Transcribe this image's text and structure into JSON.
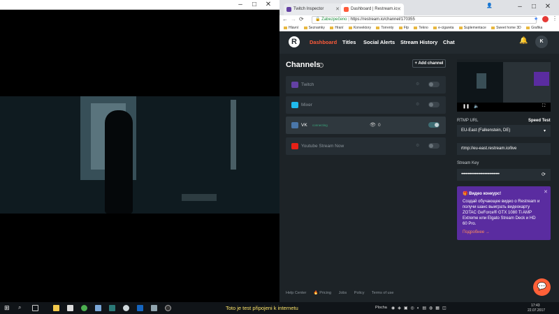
{
  "browser": {
    "tabs": [
      {
        "title": "Twitch Inspector",
        "icon_color": "#6441a4"
      },
      {
        "title": "Dashboard | Restream.io",
        "icon_color": "#ff5b3a"
      }
    ],
    "secure_label": "Zabezpečeno",
    "url": "https://restream.io/channel/170355",
    "bookmarks": [
      "Hlavní",
      "Seznamky",
      "Hraní",
      "Konvektory",
      "Torrenty",
      "Ftp",
      "Tekno",
      "e-cigareta",
      "Suplementace",
      "Sweet home 3D",
      "Grafika"
    ]
  },
  "nav": {
    "logo_letter": "R",
    "links": [
      "Dashboard",
      "Titles",
      "Social Alerts",
      "Stream History",
      "Chat"
    ],
    "avatar_letter": "K"
  },
  "channels": {
    "title": "Channels",
    "add_label": "+ Add channel",
    "items": [
      {
        "name": "Twitch",
        "icon_color": "#6441a4",
        "active": false
      },
      {
        "name": "Mixer",
        "icon_color": "#1fbaed",
        "active": false
      },
      {
        "name": "VK",
        "icon_color": "#4a76a8",
        "active": true,
        "status": "connecting",
        "viewers": "0"
      },
      {
        "name": "Youtube Stream Now",
        "icon_color": "#e62117",
        "active": false
      }
    ]
  },
  "stream": {
    "rtmp_label": "RTMP URL",
    "speed_test": "Speed Test",
    "server": "EU-East (Falkenstein, DE)",
    "rtmp_url": "rtmp://eu-east.restream.io/live",
    "key_label": "Stream Key",
    "key_value": "••••••••••••••••••••••••••••••••••"
  },
  "promo": {
    "title": "🎁 Видео конкурс!",
    "body": "Создай обучающее видео о Restream и получи шанс выиграть видеокарту ZOTAC GeForce® GTX 1080 Ti AMP Extreme или Elgato Stream Deck и HD 60 Pro.",
    "link": "Подробнее →"
  },
  "footer": [
    "Help Center",
    "🔥 Pricing",
    "Jobs",
    "Policy",
    "Terms of use"
  ],
  "taskbar": {
    "marquee": "Toto je test připojeni k internetu",
    "tray_text": "Plocha",
    "time": "17:43",
    "date": "22.07.2017"
  }
}
